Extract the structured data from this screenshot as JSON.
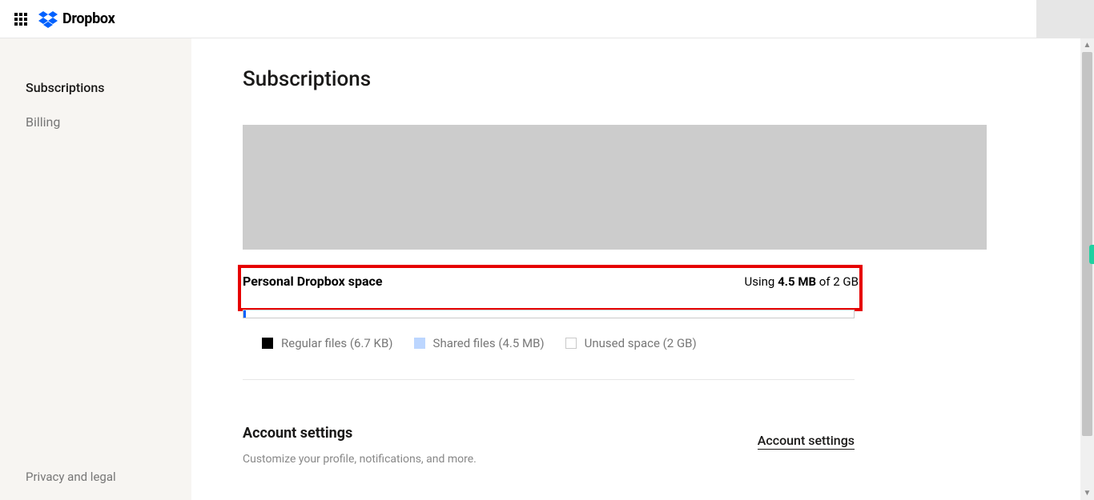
{
  "header": {
    "brand": "Dropbox"
  },
  "sidebar": {
    "items": [
      {
        "label": "Subscriptions",
        "active": true
      },
      {
        "label": "Billing",
        "active": false
      }
    ],
    "footer": "Privacy and legal"
  },
  "page": {
    "title": "Subscriptions"
  },
  "storage": {
    "title": "Personal Dropbox space",
    "using_prefix": "Using ",
    "used": "4.5 MB",
    "of_word": " of ",
    "total": "2 GB",
    "legend": [
      {
        "label": "Regular files (6.7 KB)",
        "color": "black"
      },
      {
        "label": "Shared files (4.5 MB)",
        "color": "blue"
      },
      {
        "label": "Unused space (2 GB)",
        "color": "empty"
      }
    ]
  },
  "settings": {
    "title": "Account settings",
    "desc": "Customize your profile, notifications, and more.",
    "link": "Account settings"
  }
}
